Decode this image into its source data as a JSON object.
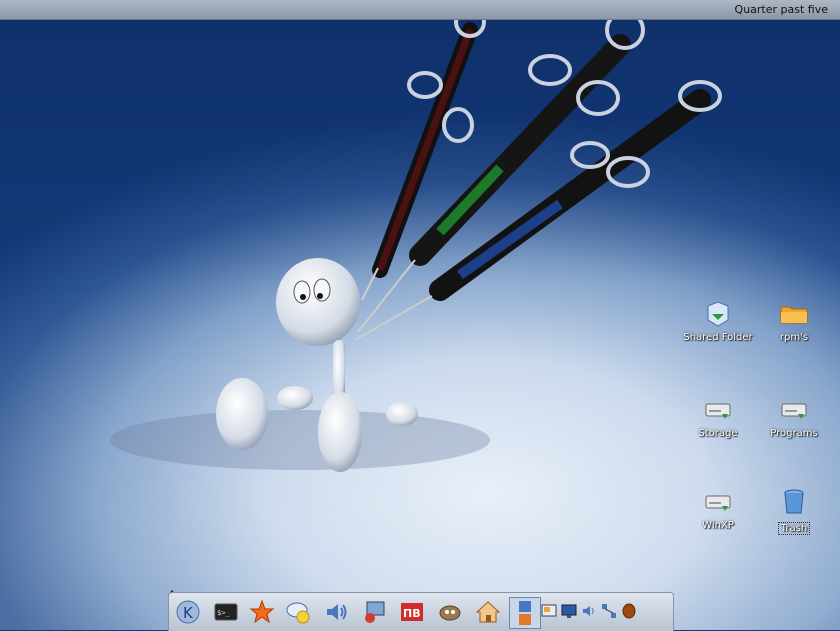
{
  "top_panel": {
    "clock_text": "Quarter past five"
  },
  "desktop": {
    "icons": [
      {
        "label": "Shared Folder",
        "icon": "shared-folder-icon"
      },
      {
        "label": "rpm's",
        "icon": "folder-icon"
      },
      {
        "label": "Storage",
        "icon": "drive-icon"
      },
      {
        "label": "Programs",
        "icon": "drive-icon"
      },
      {
        "label": "WinXP",
        "icon": "drive-icon"
      },
      {
        "label": "Trash",
        "icon": "trash-icon"
      }
    ]
  },
  "taskbar": {
    "launchers": [
      "kde-menu-icon",
      "terminal-icon",
      "favorites-star-icon",
      "messenger-icon",
      "volume-icon",
      "network-monitor-icon",
      "ktb-icon",
      "gimp-icon",
      "home-icon",
      "lock-logout-icon"
    ],
    "tray": [
      "desktop-preview-icon",
      "display-icon",
      "speaker-icon",
      "network-icon",
      "java-icon"
    ]
  },
  "colors": {
    "panel": "#aeb7c4",
    "wallpaper_dark": "#143a78",
    "wallpaper_light": "#e6eef8"
  }
}
